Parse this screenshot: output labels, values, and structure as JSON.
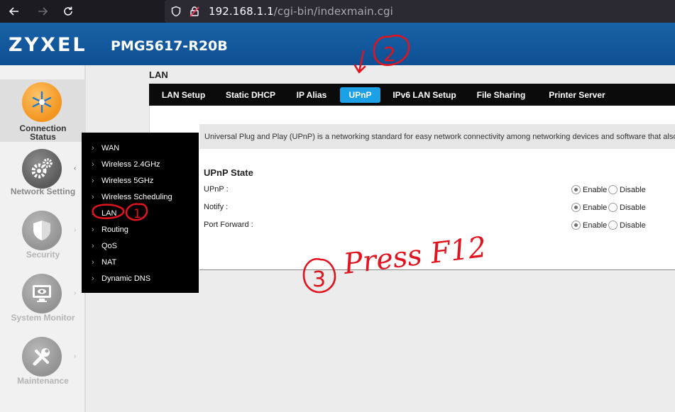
{
  "browser": {
    "url_host": "192.168.1.1",
    "url_path": "/cgi-bin/indexmain.cgi"
  },
  "header": {
    "brand": "ZYXEL",
    "model": "PMG5617-R20B"
  },
  "sidebar": {
    "items": [
      {
        "label_line1": "Connection",
        "label_line2": "Status",
        "icon": "network-icon"
      },
      {
        "label": "Network Setting",
        "icon": "gears-icon"
      },
      {
        "label": "Security",
        "icon": "shield-icon"
      },
      {
        "label": "System Monitor",
        "icon": "monitor-icon"
      },
      {
        "label": "Maintenance",
        "icon": "tools-icon"
      }
    ]
  },
  "content": {
    "title": "LAN",
    "tabs": [
      "LAN Setup",
      "Static DHCP",
      "IP Alias",
      "UPnP",
      "IPv6 LAN Setup",
      "File Sharing",
      "Printer Server"
    ],
    "active_tab": "UPnP",
    "description": "Universal Plug and Play (UPnP) is a networking standard for easy network connectivity among networking devices and software that also",
    "section_title": "UPnP State",
    "settings": [
      {
        "label": "UPnP :",
        "enable": "Enable",
        "disable": "Disable",
        "value": "Enable"
      },
      {
        "label": "Notify :",
        "enable": "Enable",
        "disable": "Disable",
        "value": "Enable"
      },
      {
        "label": "Port Forward :",
        "enable": "Enable",
        "disable": "Disable",
        "value": "Enable"
      }
    ]
  },
  "network_menu": {
    "items": [
      "WAN",
      "Wireless 2.4GHz",
      "Wireless 5GHz",
      "Wireless Scheduling",
      "LAN",
      "Routing",
      "QoS",
      "NAT",
      "Dynamic DNS"
    ]
  },
  "annotations": {
    "step1": "1",
    "step2": "2",
    "step3": "3",
    "step3_text": "Press F12"
  },
  "colors": {
    "header_blue": "#0d4f93",
    "active_tab": "#1da1e6",
    "annotation_red": "#e0141e",
    "accent_orange": "#f2941d"
  }
}
